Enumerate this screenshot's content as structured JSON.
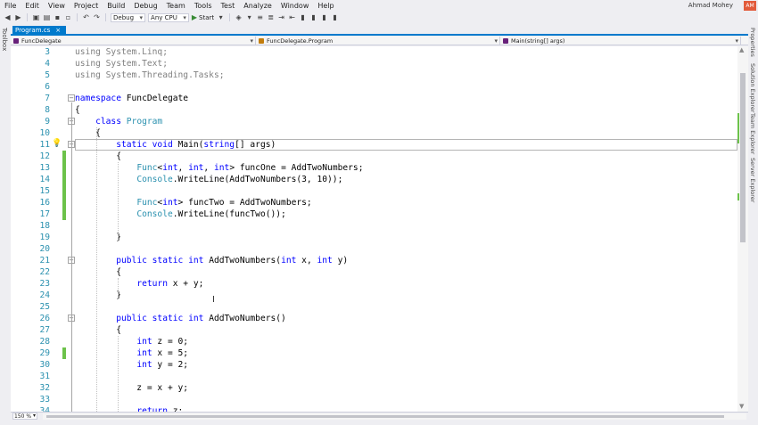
{
  "menu": {
    "items": [
      "File",
      "Edit",
      "View",
      "Project",
      "Build",
      "Debug",
      "Team",
      "Tools",
      "Test",
      "Analyze",
      "Window",
      "Help"
    ],
    "user_name": "Ahmad Mohey",
    "avatar_initials": "AM"
  },
  "toolbar": {
    "config": "Debug",
    "platform": "Any CPU",
    "start_label": "Start"
  },
  "sidebars": {
    "left": "Toolbox",
    "right": [
      "Properties",
      "Solution Explorer",
      "Team Explorer",
      "Server Explorer"
    ]
  },
  "tab": {
    "name": "Program.cs",
    "close": "×"
  },
  "navbar": {
    "project": "FuncDelegate",
    "class": "FuncDelegate.Program",
    "member": "Main(string[] args)"
  },
  "editor": {
    "lines": [
      {
        "n": "3",
        "text": "using System.Linq;"
      },
      {
        "n": "4",
        "text": "using System.Text;"
      },
      {
        "n": "5",
        "text": "using System.Threading.Tasks;"
      },
      {
        "n": "6",
        "text": ""
      },
      {
        "n": "7",
        "text": "namespace FuncDelegate"
      },
      {
        "n": "8",
        "text": "{"
      },
      {
        "n": "9",
        "text": "    class Program"
      },
      {
        "n": "10",
        "text": "    {"
      },
      {
        "n": "11",
        "text": "        static void Main(string[] args)"
      },
      {
        "n": "12",
        "text": "        {"
      },
      {
        "n": "13",
        "text": "            Func<int, int, int> funcOne = AddTwoNumbers;"
      },
      {
        "n": "14",
        "text": "            Console.WriteLine(AddTwoNumbers(3, 10));"
      },
      {
        "n": "15",
        "text": ""
      },
      {
        "n": "16",
        "text": "            Func<int> funcTwo = AddTwoNumbers;"
      },
      {
        "n": "17",
        "text": "            Console.WriteLine(funcTwo());"
      },
      {
        "n": "18",
        "text": ""
      },
      {
        "n": "19",
        "text": "        }"
      },
      {
        "n": "20",
        "text": ""
      },
      {
        "n": "21",
        "text": "        public static int AddTwoNumbers(int x, int y)"
      },
      {
        "n": "22",
        "text": "        {"
      },
      {
        "n": "23",
        "text": "            return x + y;"
      },
      {
        "n": "24",
        "text": "        }"
      },
      {
        "n": "25",
        "text": ""
      },
      {
        "n": "26",
        "text": "        public static int AddTwoNumbers()"
      },
      {
        "n": "27",
        "text": "        {"
      },
      {
        "n": "28",
        "text": "            int z = 0;"
      },
      {
        "n": "29",
        "text": "            int x = 5;"
      },
      {
        "n": "30",
        "text": "            int y = 2;"
      },
      {
        "n": "31",
        "text": ""
      },
      {
        "n": "32",
        "text": "            z = x + y;"
      },
      {
        "n": "33",
        "text": ""
      },
      {
        "n": "34",
        "text": "            return z;"
      }
    ]
  },
  "zoom": "150 %",
  "colors": {
    "keyword": "#0000ff",
    "type": "#2b91af",
    "line_number": "#2b91af",
    "changed_marker": "#6cc24a",
    "accent": "#007acc"
  }
}
